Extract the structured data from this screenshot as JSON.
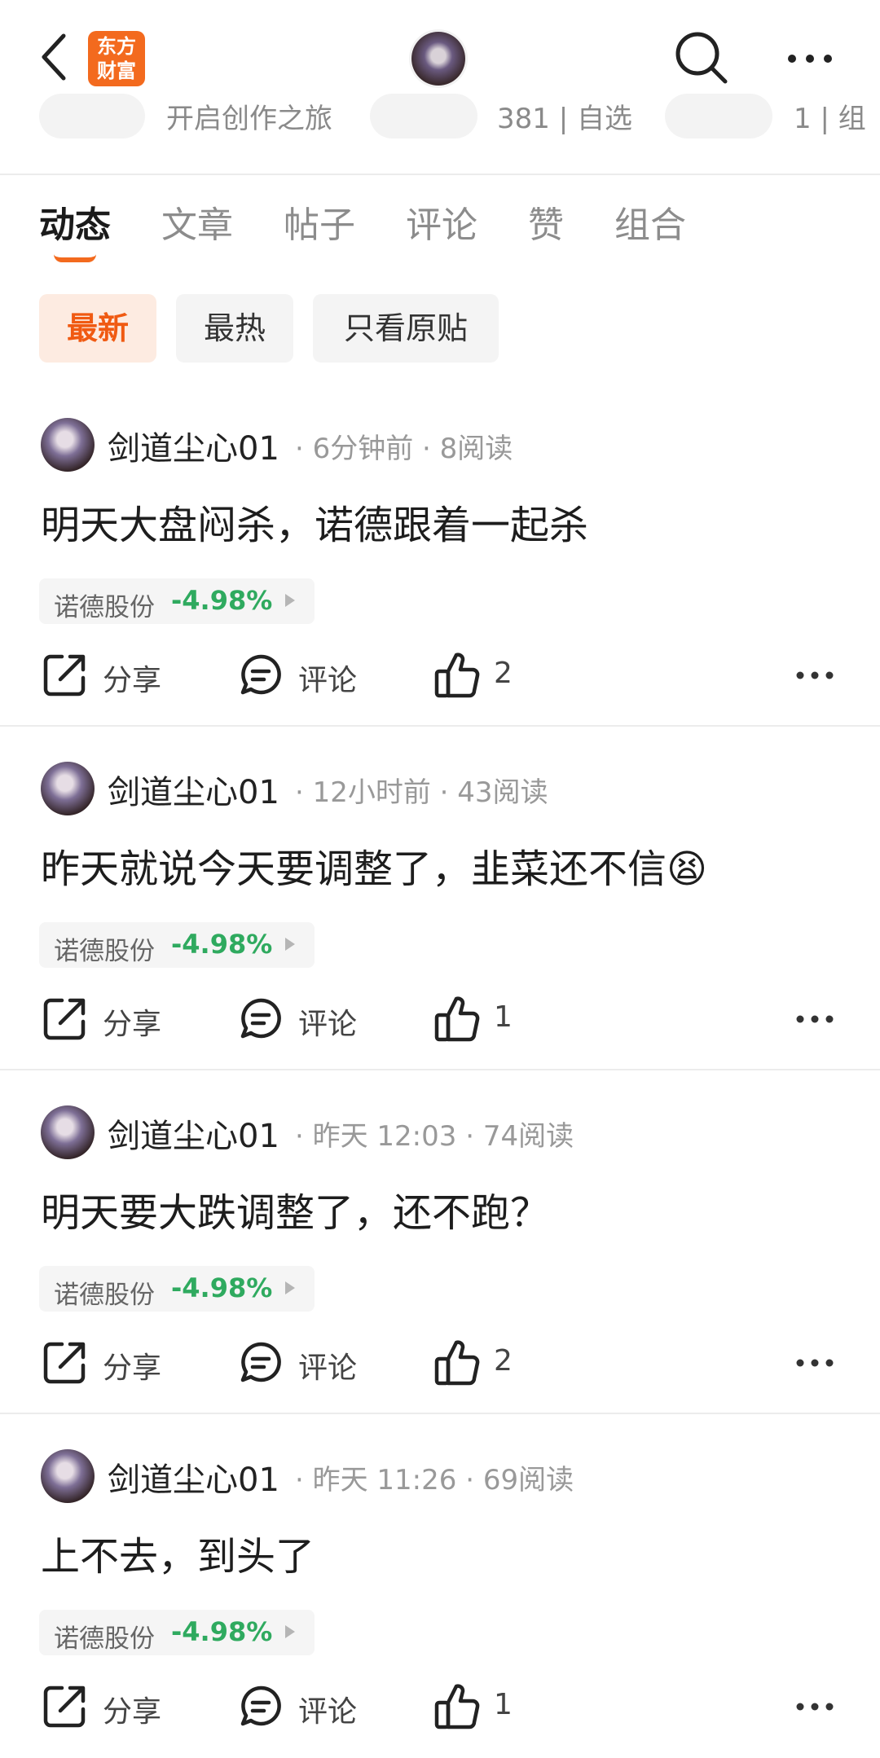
{
  "header": {
    "logo_line1": "东方",
    "logo_line2": "财富",
    "peek_items": [
      "开启创作之旅",
      "381 | 自选",
      "1 | 组"
    ]
  },
  "tabs": [
    {
      "label": "动态",
      "active": true
    },
    {
      "label": "文章",
      "active": false
    },
    {
      "label": "帖子",
      "active": false
    },
    {
      "label": "评论",
      "active": false
    },
    {
      "label": "赞",
      "active": false
    },
    {
      "label": "组合",
      "active": false
    }
  ],
  "filters": [
    {
      "label": "最新",
      "active": true
    },
    {
      "label": "最热",
      "active": false
    },
    {
      "label": "只看原贴",
      "active": false
    }
  ],
  "action_labels": {
    "share": "分享",
    "comment": "评论"
  },
  "colors": {
    "brand": "#f36a1e",
    "down": "#2faa5f"
  },
  "posts": [
    {
      "author": "剑道尘心01",
      "meta": "· 6分钟前 · 8阅读",
      "text": "明天大盘闷杀，诺德跟着一起杀",
      "stock_name": "诺德股份",
      "stock_change": "-4.98%",
      "likes": "2"
    },
    {
      "author": "剑道尘心01",
      "meta": "· 12小时前 · 43阅读",
      "text": "昨天就说今天要调整了，韭菜还不信😫",
      "stock_name": "诺德股份",
      "stock_change": "-4.98%",
      "likes": "1"
    },
    {
      "author": "剑道尘心01",
      "meta": "· 昨天 12:03 · 74阅读",
      "text": "明天要大跌调整了，还不跑？",
      "stock_name": "诺德股份",
      "stock_change": "-4.98%",
      "likes": "2"
    },
    {
      "author": "剑道尘心01",
      "meta": "· 昨天 11:26 · 69阅读",
      "text": "上不去，到头了",
      "stock_name": "诺德股份",
      "stock_change": "-4.98%",
      "likes": "1"
    }
  ]
}
